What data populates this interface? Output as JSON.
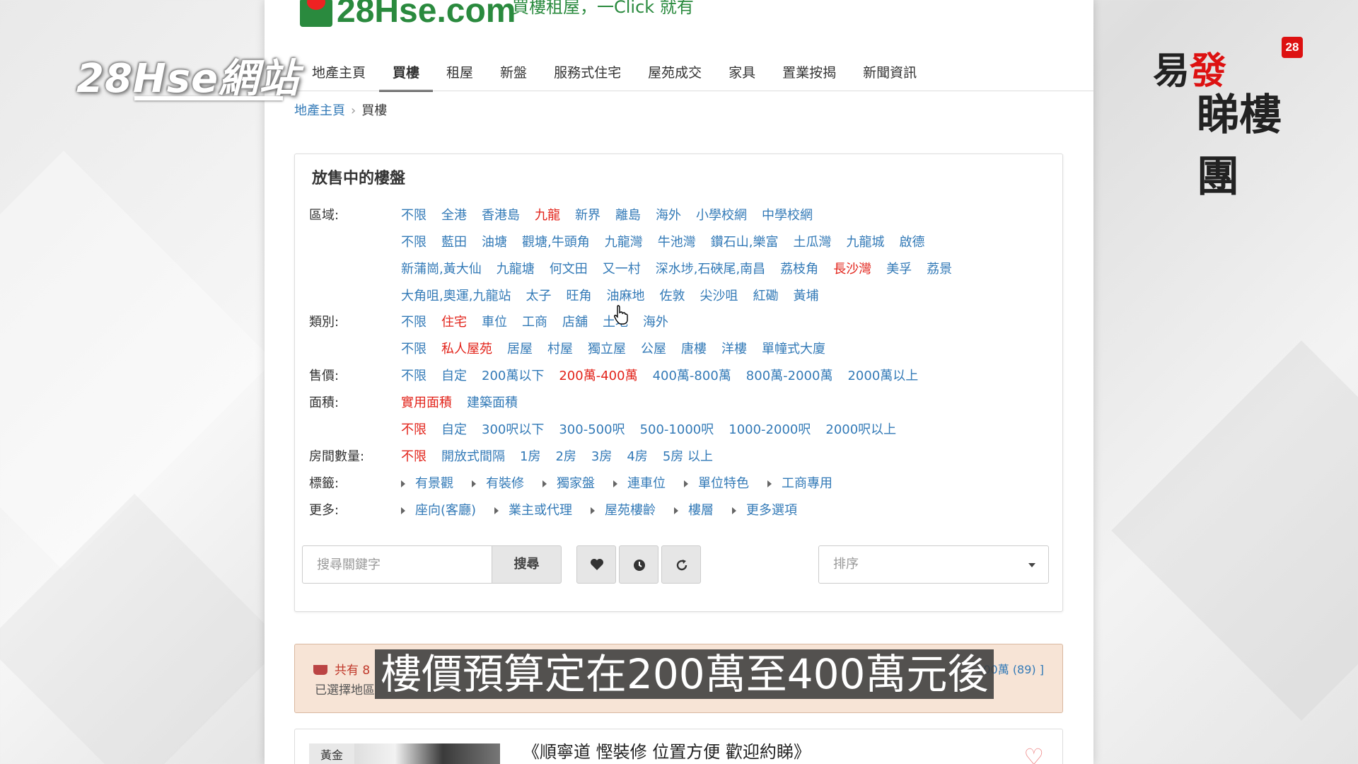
{
  "overlay": {
    "brand": "28Hse網站",
    "subtitle": "樓價預算定在200萬至400萬元後"
  },
  "corner_logo": {
    "line1_a": "易",
    "line1_b": "發",
    "line2": "睇樓團",
    "badge": "28"
  },
  "site": {
    "logo": "28Hse.com",
    "slogan": "買樓租屋，一Click 就有"
  },
  "nav": {
    "items": [
      "地產主頁",
      "買樓",
      "租屋",
      "新盤",
      "服務式住宅",
      "屋苑成交",
      "家具",
      "置業按揭",
      "新聞資訊"
    ],
    "active": "買樓"
  },
  "breadcrumb": {
    "home": "地產主頁",
    "separator": "›",
    "current": "買樓"
  },
  "filter": {
    "title": "放售中的樓盤",
    "region_label": "區域:",
    "region_row1": [
      "不限",
      "全港",
      "香港島",
      "九龍",
      "新界",
      "離島",
      "海外",
      "小學校網",
      "中學校網"
    ],
    "region_row2": [
      "不限",
      "藍田",
      "油塘",
      "觀塘,牛頭角",
      "九龍灣",
      "牛池灣",
      "鑽石山,樂富",
      "土瓜灣",
      "九龍城",
      "啟德"
    ],
    "region_row3": [
      "新蒲崗,黃大仙",
      "九龍塘",
      "何文田",
      "又一村",
      "深水埗,石硤尾,南昌",
      "荔枝角",
      "長沙灣",
      "美孚",
      "荔景"
    ],
    "region_row4": [
      "大角咀,奧運,九龍站",
      "太子",
      "旺角",
      "油麻地",
      "佐敦",
      "尖沙咀",
      "紅磡",
      "黃埔"
    ],
    "type_label": "類別:",
    "type_row1": [
      "不限",
      "住宅",
      "車位",
      "工商",
      "店舖",
      "土地",
      "海外"
    ],
    "type_row2": [
      "不限",
      "私人屋苑",
      "居屋",
      "村屋",
      "獨立屋",
      "公屋",
      "唐樓",
      "洋樓",
      "單幢式大廈"
    ],
    "price_label": "售價:",
    "price_row": [
      "不限",
      "自定",
      "200萬以下",
      "200萬-400萬",
      "400萬-800萬",
      "800萬-2000萬",
      "2000萬以上"
    ],
    "area_label": "面積:",
    "area_row1": [
      "實用面積",
      "建築面積"
    ],
    "area_row2": [
      "不限",
      "自定",
      "300呎以下",
      "300-500呎",
      "500-1000呎",
      "1000-2000呎",
      "2000呎以上"
    ],
    "rooms_label": "房間數量:",
    "rooms_row": [
      "不限",
      "開放式間隔",
      "1房",
      "2房",
      "3房",
      "4房",
      "5房 以上"
    ],
    "tags_label": "標籤:",
    "tags_row": [
      "有景觀",
      "有裝修",
      "獨家盤",
      "連車位",
      "單位特色",
      "工商專用"
    ],
    "more_label": "更多:",
    "more_row": [
      "座向(客廳)",
      "業主或代理",
      "屋苑樓齡",
      "樓層",
      "更多選項"
    ]
  },
  "search": {
    "placeholder": "搜尋關鍵字",
    "button": "搜尋",
    "sort_placeholder": "排序"
  },
  "results": {
    "count_text": "共有 8",
    "selected_text": "已選擇地區",
    "right_text": "400萬 (89) ]"
  },
  "listing": {
    "badge": "黃金",
    "title": "《順寧道 慳裝修 位置方便 歡迎約睇》"
  },
  "colors": {
    "link": "#337ab7",
    "selected": "#e2231a",
    "brand_green": "#2a8a3e"
  }
}
